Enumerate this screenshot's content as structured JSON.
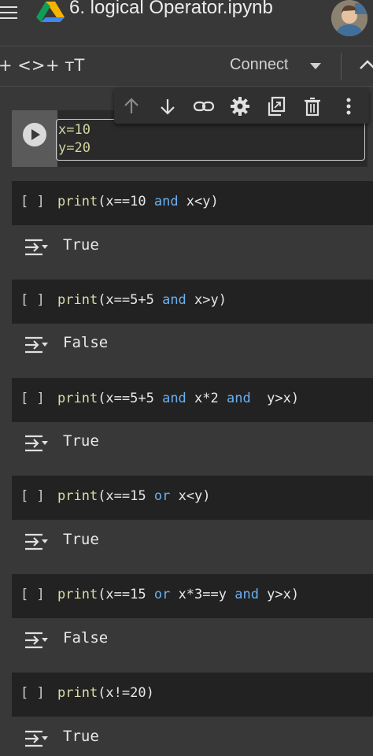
{
  "header": {
    "title": "6. logical Operator.ipynb",
    "menu_icon": "hamburger-menu-icon",
    "logo_icon": "google-drive-icon",
    "avatar_icon": "user-avatar"
  },
  "toolbar": {
    "add_code_label": "+ <>",
    "add_text_label": "+ тT",
    "connect_label": "Connect",
    "connect_icon": "caret-down-icon",
    "collapse_icon": "chevron-up-icon"
  },
  "cell_toolbar": {
    "icons": [
      "arrow-up-icon",
      "arrow-down-icon",
      "link-icon",
      "gear-icon",
      "mirror-cell-icon",
      "trash-icon",
      "more-vert-icon"
    ]
  },
  "first_cell": {
    "line1": "x=10",
    "line2": "y=20"
  },
  "cells": [
    {
      "bracket": "[ ]",
      "fn": "print",
      "tokens": [
        [
          "(x==10 ",
          "p"
        ],
        [
          "and",
          "k"
        ],
        [
          " x<y)",
          "p"
        ]
      ],
      "output": "True"
    },
    {
      "bracket": "[ ]",
      "fn": "print",
      "tokens": [
        [
          "(x==5+5 ",
          "p"
        ],
        [
          "and",
          "k"
        ],
        [
          " x>y)",
          "p"
        ]
      ],
      "output": "False"
    },
    {
      "bracket": "[ ]",
      "fn": "print",
      "tokens": [
        [
          "(x==5+5 ",
          "p"
        ],
        [
          "and",
          "k"
        ],
        [
          " x*2 ",
          "p"
        ],
        [
          "and",
          "k"
        ],
        [
          "  y>x)",
          "p"
        ]
      ],
      "output": "True"
    },
    {
      "bracket": "[ ]",
      "fn": "print",
      "tokens": [
        [
          "(x==15 ",
          "p"
        ],
        [
          "or",
          "k"
        ],
        [
          " x<y)",
          "p"
        ]
      ],
      "output": "True"
    },
    {
      "bracket": "[ ]",
      "fn": "print",
      "tokens": [
        [
          "(x==15 ",
          "p"
        ],
        [
          "or",
          "k"
        ],
        [
          " x*3==y ",
          "p"
        ],
        [
          "and",
          "k"
        ],
        [
          " y>x)",
          "p"
        ]
      ],
      "output": "False"
    },
    {
      "bracket": "[ ]",
      "fn": "print",
      "tokens": [
        [
          "(x!=20)",
          "p"
        ]
      ],
      "output": "True"
    }
  ],
  "colors": {
    "background": "#383838",
    "cell_background": "#222222",
    "keyword": "#6cb0f0",
    "function": "#dcdcaa"
  }
}
